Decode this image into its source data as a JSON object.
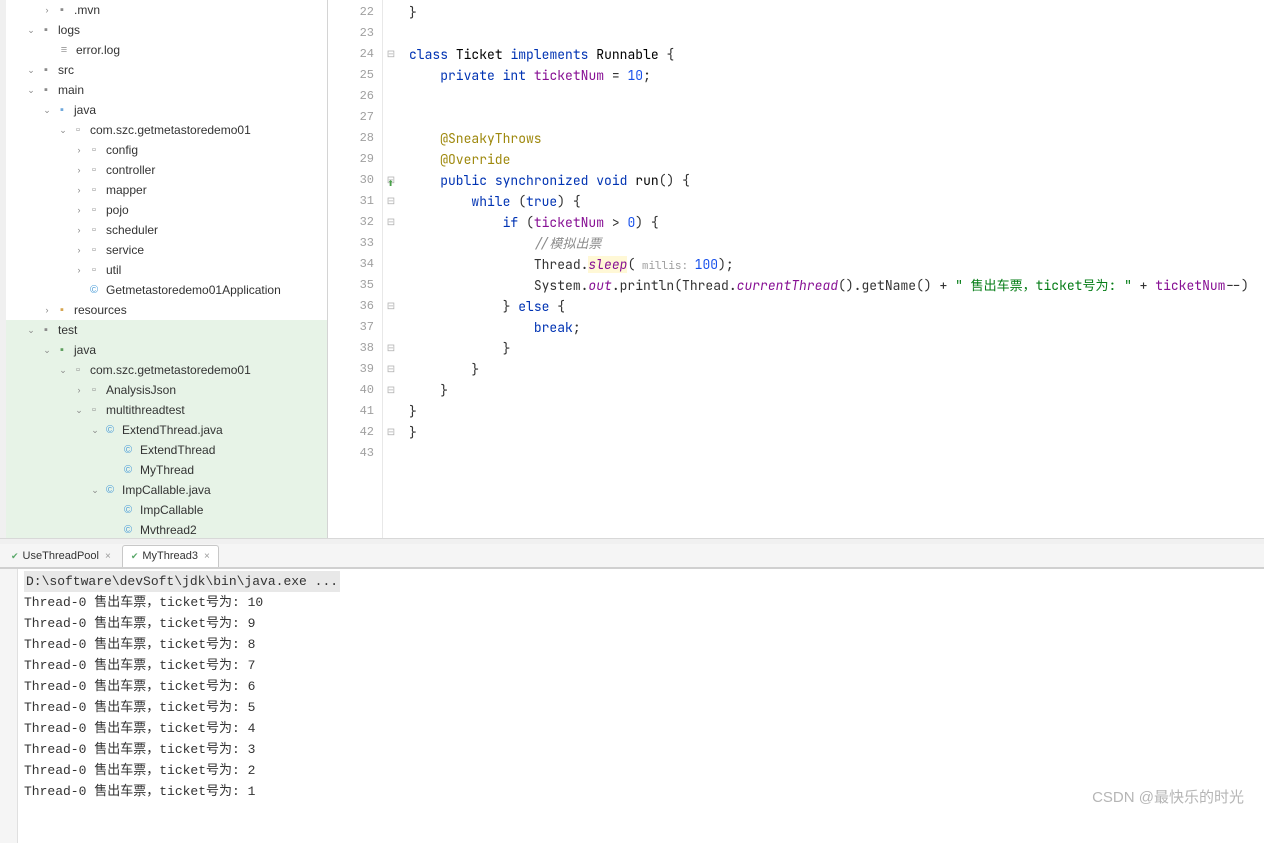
{
  "tree": {
    "mvn": ".mvn",
    "logs": "logs",
    "errorlog": "error.log",
    "src": "src",
    "main": "main",
    "java": "java",
    "pkg1": "com.szc.getmetastoredemo01",
    "config": "config",
    "controller": "controller",
    "mapper": "mapper",
    "pojo": "pojo",
    "scheduler": "scheduler",
    "service": "service",
    "util": "util",
    "app": "Getmetastoredemo01Application",
    "resources": "resources",
    "test": "test",
    "java2": "java",
    "pkg2": "com.szc.getmetastoredemo01",
    "analysis": "AnalysisJson",
    "multi": "multithreadtest",
    "extfile": "ExtendThread.java",
    "extcls": "ExtendThread",
    "mythread": "MyThread",
    "impfile": "ImpCallable.java",
    "impcls": "ImpCallable",
    "mythread2": "Mvthread2"
  },
  "gutter": [
    "22",
    "23",
    "24",
    "25",
    "26",
    "27",
    "28",
    "29",
    "30",
    "31",
    "32",
    "33",
    "34",
    "35",
    "36",
    "37",
    "38",
    "39",
    "40",
    "41",
    "42",
    "43"
  ],
  "code": {
    "class_kw": "class",
    "class_name": "Ticket",
    "implements": "implements",
    "iface": "Runnable",
    "brace_open": "{",
    "private": "private",
    "int": "int",
    "field": "ticketNum",
    "eq": " = ",
    "ten": "10",
    "semi": ";",
    "sneaky": "@SneakyThrows",
    "override": "@Override",
    "public": "public",
    "sync": "synchronized",
    "void": "void",
    "run": "run",
    "parens": "()",
    "while": "while",
    "true": "true",
    "if": "if",
    "gt": " > ",
    "zero": "0",
    "cmt": "//模拟出票",
    "thread": "Thread.",
    "sleep": "sleep",
    "hint": " millis: ",
    "hundred": "100",
    "sys": "System.",
    "out": "out",
    "println": ".println(Thread.",
    "curThread": "currentThread",
    "getName": "().getName() + ",
    "str1": "\" 售出车票，ticket号为: \"",
    "plus": " + ",
    "dec": "--)",
    "else": "else",
    "break": "break",
    "brace_close": "}"
  },
  "runTabs": {
    "pool": "UseThreadPool",
    "mt3": "MyThread3"
  },
  "console": {
    "cmd": "D:\\software\\devSoft\\jdk\\bin\\java.exe ...",
    "lines": [
      "Thread-0 售出车票，ticket号为: 10",
      "Thread-0 售出车票，ticket号为: 9",
      "Thread-0 售出车票，ticket号为: 8",
      "Thread-0 售出车票，ticket号为: 7",
      "Thread-0 售出车票，ticket号为: 6",
      "Thread-0 售出车票，ticket号为: 5",
      "Thread-0 售出车票，ticket号为: 4",
      "Thread-0 售出车票，ticket号为: 3",
      "Thread-0 售出车票，ticket号为: 2",
      "Thread-0 售出车票，ticket号为: 1"
    ]
  },
  "watermark": "CSDN @最快乐的时光"
}
